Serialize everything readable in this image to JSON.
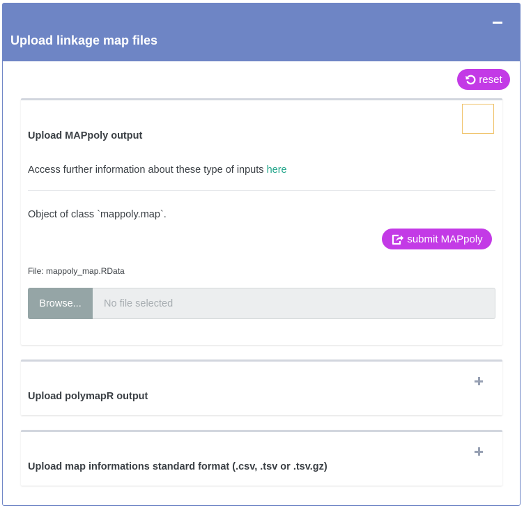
{
  "panel": {
    "title": "Upload linkage map files",
    "collapse_icon": "minus-icon"
  },
  "reset_button": {
    "icon": "undo-icon",
    "label": "reset"
  },
  "mappoly_box": {
    "title": "Upload MAPpoly output",
    "info_text": "Access further information about these type of inputs ",
    "info_link": "here",
    "class_text": "Object of class `mappoly.map`.",
    "submit_icon": "share-square-icon",
    "submit_label": "submit MAPpoly",
    "file_label": "File: mappoly_map.RData",
    "browse_label": "Browse...",
    "file_placeholder": "No file selected"
  },
  "polymapr_box": {
    "title": "Upload polymapR output",
    "expand_icon": "plus-icon"
  },
  "standard_box": {
    "title": "Upload map informations standard format (.csv, .tsv or .tsv.gz)",
    "expand_icon": "plus-icon"
  },
  "colors": {
    "header_bg": "#6e85c5",
    "accent_button": "#c33ae6",
    "link": "#22a58a",
    "browse_button": "#95a5a6",
    "checkbox_border": "#f0c36b"
  }
}
